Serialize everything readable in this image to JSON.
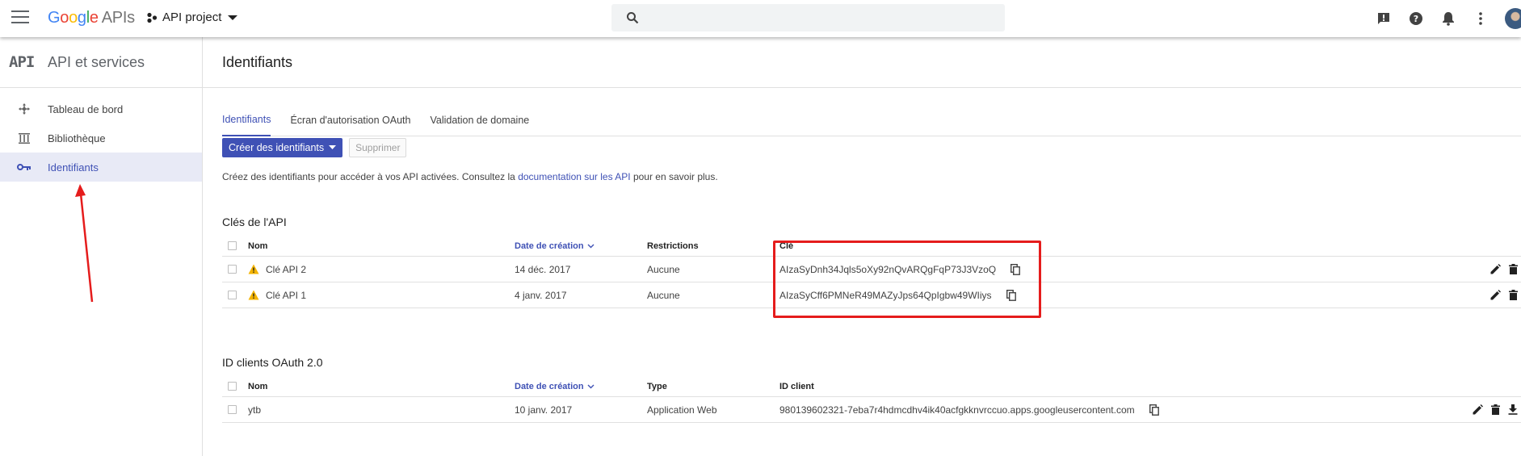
{
  "topbar": {
    "logo_google": [
      "G",
      "o",
      "o",
      "g",
      "l",
      "e"
    ],
    "logo_suffix": "APIs",
    "project_name": "API project"
  },
  "sidebar": {
    "api_mark": "API",
    "title": "API et services",
    "items": [
      {
        "label": "Tableau de bord",
        "icon": "dashboard-icon",
        "active": false
      },
      {
        "label": "Bibliothèque",
        "icon": "library-icon",
        "active": false
      },
      {
        "label": "Identifiants",
        "icon": "key-icon",
        "active": true
      }
    ]
  },
  "page": {
    "title": "Identifiants",
    "tabs": [
      {
        "label": "Identifiants",
        "active": true
      },
      {
        "label": "Écran d'autorisation OAuth",
        "active": false
      },
      {
        "label": "Validation de domaine",
        "active": false
      }
    ],
    "create_button": "Créer des identifiants",
    "delete_button": "Supprimer",
    "description_before": "Créez des identifiants pour accéder à vos API activées. Consultez la ",
    "description_link": "documentation sur les API",
    "description_after": " pour en savoir plus."
  },
  "api_keys": {
    "section_title": "Clés de l'API",
    "headers": {
      "name": "Nom",
      "date": "Date de création",
      "restrictions": "Restrictions",
      "key": "Clé"
    },
    "rows": [
      {
        "name": "Clé API 2",
        "date": "14 déc. 2017",
        "restrictions": "Aucune",
        "key": "AIzaSyDnh34Jqls5oXy92nQvARQgFqP73J3VzoQ"
      },
      {
        "name": "Clé API 1",
        "date": "4 janv. 2017",
        "restrictions": "Aucune",
        "key": "AIzaSyCff6PMNeR49MAZyJps64QpIgbw49WIiys"
      }
    ]
  },
  "oauth_clients": {
    "section_title": "ID clients OAuth 2.0",
    "headers": {
      "name": "Nom",
      "date": "Date de création",
      "type": "Type",
      "client_id": "ID client"
    },
    "rows": [
      {
        "name": "ytb",
        "date": "10 janv. 2017",
        "type": "Application Web",
        "client_id": "980139602321-7eba7r4hdmcdhv4ik40acfgkknvrccuo.apps.googleusercontent.com"
      }
    ]
  },
  "colors": {
    "accent": "#3f51b5",
    "annotation": "#e51c1c",
    "warning": "#f4b400"
  }
}
